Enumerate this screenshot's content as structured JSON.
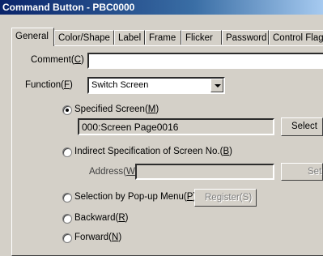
{
  "window": {
    "title": "Command Button - PBC0000"
  },
  "tabs": [
    {
      "label": "General"
    },
    {
      "label": "Color/Shape"
    },
    {
      "label": "Label"
    },
    {
      "label": "Frame"
    },
    {
      "label": "Flicker"
    },
    {
      "label": "Password"
    },
    {
      "label": "Control Flag"
    }
  ],
  "general": {
    "comment_label": "Comment(",
    "comment_key": "C",
    "comment_value": "",
    "function_label": "Function(",
    "function_key": "F",
    "function_value": "Switch Screen",
    "specified_label": "Specified Screen(",
    "specified_key": "M",
    "screen_value": "000:Screen Page0016",
    "select_button": "Select",
    "indirect_label": "Indirect Specification of Screen No.(",
    "indirect_key": "B",
    "address_label": "Address(",
    "address_key": "W",
    "address_value": "",
    "set_button": "Set",
    "popup_label": "Selection by Pop-up Menu(",
    "popup_key": "P",
    "register_button": "Register(S)",
    "backward_label": "Backward(",
    "backward_key": "R",
    "forward_label": "Forward(",
    "forward_key": "N"
  }
}
